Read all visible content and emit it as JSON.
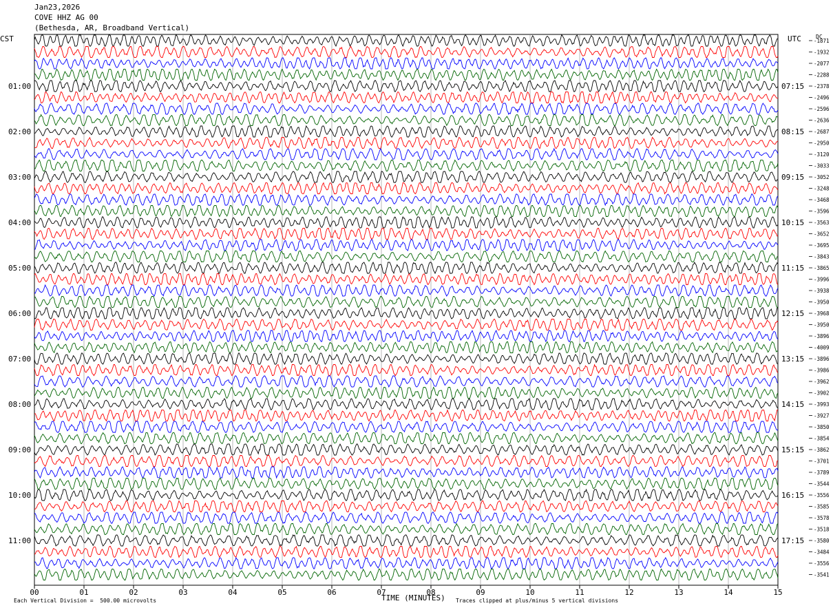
{
  "header": {
    "date": "Jan23,2026",
    "station": "COVE HHZ AG 00",
    "location": "(Bethesda, AR, Broadband Vertical)"
  },
  "left_tz": "CST",
  "right_tz": "UTC",
  "dc_label": "DC",
  "footer": {
    "scale_note": "Each Vertical Division =  500.00 microvolts",
    "clip_note": "Traces clipped at plus/minus 5 vertical divisions",
    "x_label": "TIME (MINUTES)"
  },
  "colors": [
    "#000000",
    "#ff0000",
    "#0000ff",
    "#006400"
  ],
  "chart_data": {
    "type": "line",
    "title": "Jan23,2026 COVE HHZ AG 00 (Bethesda, AR, Broadband Vertical)",
    "xlabel": "TIME (MINUTES)",
    "x_ticks": [
      "00",
      "01",
      "02",
      "03",
      "04",
      "05",
      "06",
      "07",
      "08",
      "09",
      "10",
      "11",
      "12",
      "13",
      "14",
      "15"
    ],
    "xlim": [
      0,
      15
    ],
    "trace_minutes": 15,
    "left_hour_labels": [
      "01:00",
      "02:00",
      "03:00",
      "04:00",
      "05:00",
      "06:00",
      "07:00",
      "08:00",
      "09:00",
      "10:00",
      "11:00"
    ],
    "right_hour_labels": [
      "07:15",
      "08:15",
      "09:15",
      "10:15",
      "11:15",
      "12:15",
      "13:15",
      "14:15",
      "15:15",
      "16:15",
      "17:15"
    ],
    "dc_offsets": [
      "-1871",
      "-1932",
      "-2077",
      "-2288",
      "-2378",
      "-2496",
      "-2596",
      "-2636",
      "-2687",
      "-2950",
      "-3120",
      "-3033",
      "-3052",
      "-3248",
      "-3468",
      "-3596",
      "-3563",
      "-3652",
      "-3695",
      "-3843",
      "-3865",
      "-3996",
      "-3938",
      "-3950",
      "-3968",
      "-3950",
      "-3896",
      "-4009",
      "-3896",
      "-3986",
      "-3962",
      "-3902",
      "-3993",
      "-3927",
      "-3850",
      "-3854",
      "-3862",
      "-3701",
      "-3789",
      "-3544",
      "-3556",
      "-3585",
      "-3578",
      "-3518",
      "-3580",
      "-3484",
      "-3556",
      "-3541"
    ],
    "grid": true
  }
}
